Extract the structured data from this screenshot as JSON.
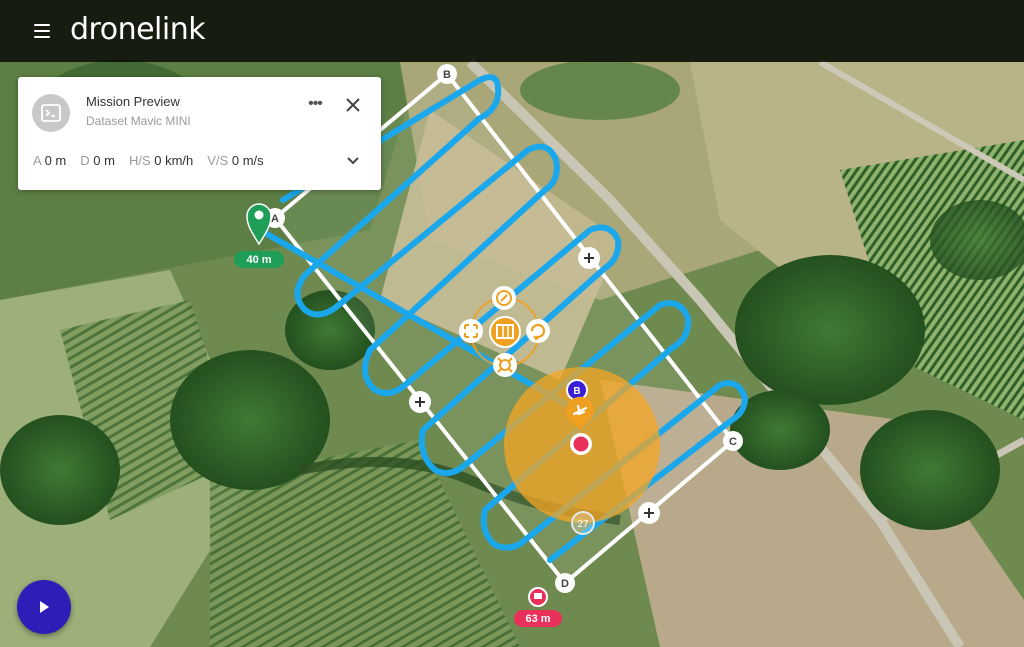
{
  "app": {
    "brand": "dronelink"
  },
  "panel": {
    "title": "Mission Preview",
    "subtitle": "Dataset Mavic MINI",
    "stats": [
      {
        "key": "A",
        "value": "0 m"
      },
      {
        "key": "D",
        "value": "0 m"
      },
      {
        "key": "H/S",
        "value": "0 km/h"
      },
      {
        "key": "V/S",
        "value": "0 m/s"
      }
    ]
  },
  "markers": {
    "corners": [
      "A",
      "B",
      "C",
      "D"
    ],
    "start_altitude": "40 m",
    "end_altitude": "63 m",
    "waypoint_number": "27",
    "vehicle_badge": "B"
  },
  "colors": {
    "flight_path": "#1aa7ec",
    "boundary": "#ffffff",
    "controls": "#f0a020",
    "vehicle_range": "#f5a623",
    "start_marker": "#1e9e57",
    "end_marker": "#e8305a",
    "play_button": "#2f1db8"
  },
  "icons": {
    "menu": "hamburger-icon",
    "mission": "terminal-icon",
    "more": "more-horizontal-icon",
    "close": "close-icon",
    "expand": "chevron-down-icon",
    "play": "play-icon",
    "rotate": "rotate-icon",
    "compass": "compass-icon",
    "map": "map-icon",
    "aircraft": "aircraft-icon",
    "add": "plus-icon"
  }
}
